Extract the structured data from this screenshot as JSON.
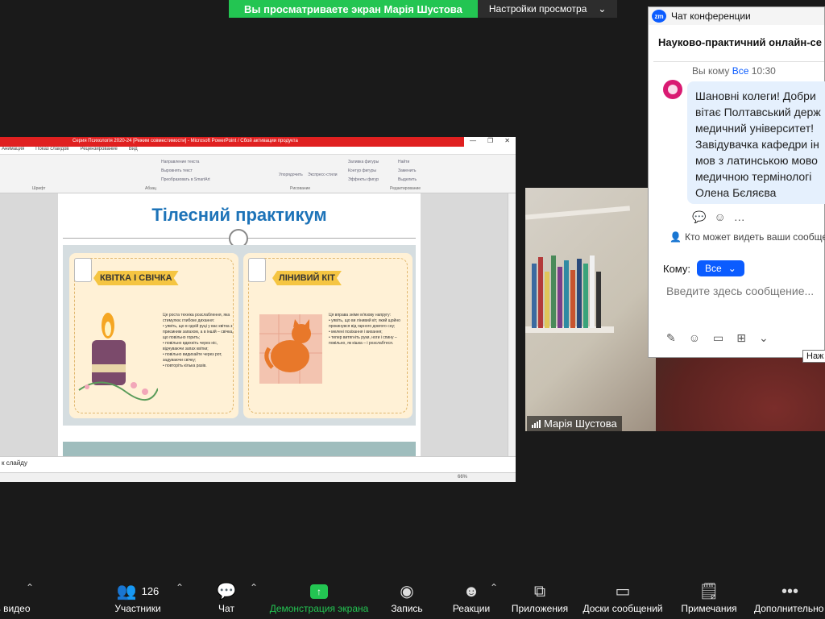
{
  "banner": {
    "viewing_text": "Вы просматриваете экран Марія Шустова",
    "view_settings": "Настройки просмотра",
    "caret": "⌄"
  },
  "shared_screen": {
    "window_title": "Серия Психологія 2020-24 [Режим совместимости] - Microsoft PowerPoint / Сбой активации продукта",
    "win_controls": [
      "—",
      "❐",
      "✕"
    ],
    "menu_tabs": [
      "Анимация",
      "Показ слайдов",
      "Рецензирование",
      "Вид"
    ],
    "ribbon_groups": [
      "Шрифт",
      "Абзац",
      "Рисование",
      "Редактирование"
    ],
    "ribbon_commands": [
      "Направление текста",
      "Выровнять текст",
      "Преобразовать в SmartArt",
      "Упорядочить",
      "Экспресс-стили",
      "Заливка фигуры",
      "Контур фигуры",
      "Эффекты фигур",
      "Найти",
      "Заменить",
      "Выделить"
    ],
    "slide": {
      "title": "Тілесний практикум",
      "cards": [
        {
          "heading": "КВІТКА І СВІЧКА",
          "text": "Це роста техніка розслаблення, яка стимулює глибоке дихання:\n• уявіть, що в одній руці у вас квітка з приємним запахом, а в іншій – свічка, що повільно горить;\n• повільно вдихніть через ніс, відчуваючи запах квітки;\n• повільно видихайте через рот, задуваючи свічку;\n• повторіть кілька разів."
        },
        {
          "heading": "ЛІНИВИЙ КІТ",
          "text": "Ця вправа зніме м'язову напругу:\n• уявіть, що ви лінивий кіт, який щойно прокинувся від гарного довгого сну;\n• мелені позіхання і вихання;\n• тепер витягніть руки, ноги і спину – повільно, як кішка – і розслабтеся."
        }
      ]
    },
    "notes_text": "к слайду",
    "status_zoom": "66%"
  },
  "video": {
    "participant_name": "Марія Шустова"
  },
  "chat": {
    "header_title": "Чат конференции",
    "app_badge": "zm",
    "meeting_name": "Науково-практичний онлайн-се",
    "meta_from": "Вы кому",
    "meta_to": "Все",
    "meta_time": "10:30",
    "message": "Шановні колеги! Добри\nвітає Полтавський держ\nмедичний університет!\nЗавідувачка кафедри ін\nмов з латинською мово\nмедичною термінологі\nОлена Бєляєва",
    "who_can_see": "Кто может видеть ваши сообще",
    "to_label": "Кому:",
    "to_value": "Все",
    "input_placeholder": "Введите здесь сообщение...",
    "tooltip": "Наж"
  },
  "toolbar": {
    "items": [
      {
        "label": "ь видео",
        "icon": "camera-icon"
      },
      {
        "label": "Участники",
        "count": "126",
        "icon": "participants-icon"
      },
      {
        "label": "Чат",
        "icon": "chat-icon"
      },
      {
        "label": "Демонстрация экрана",
        "icon": "share-screen-icon"
      },
      {
        "label": "Запись",
        "icon": "record-icon"
      },
      {
        "label": "Реакции",
        "icon": "reactions-icon"
      },
      {
        "label": "Приложения",
        "icon": "apps-icon"
      },
      {
        "label": "Доски сообщений",
        "icon": "whiteboard-icon"
      },
      {
        "label": "Примечания",
        "icon": "notes-icon"
      },
      {
        "label": "Дополнительно",
        "icon": "more-icon"
      }
    ],
    "colors": {
      "share": "#23c552",
      "text": "#ffffff"
    }
  }
}
